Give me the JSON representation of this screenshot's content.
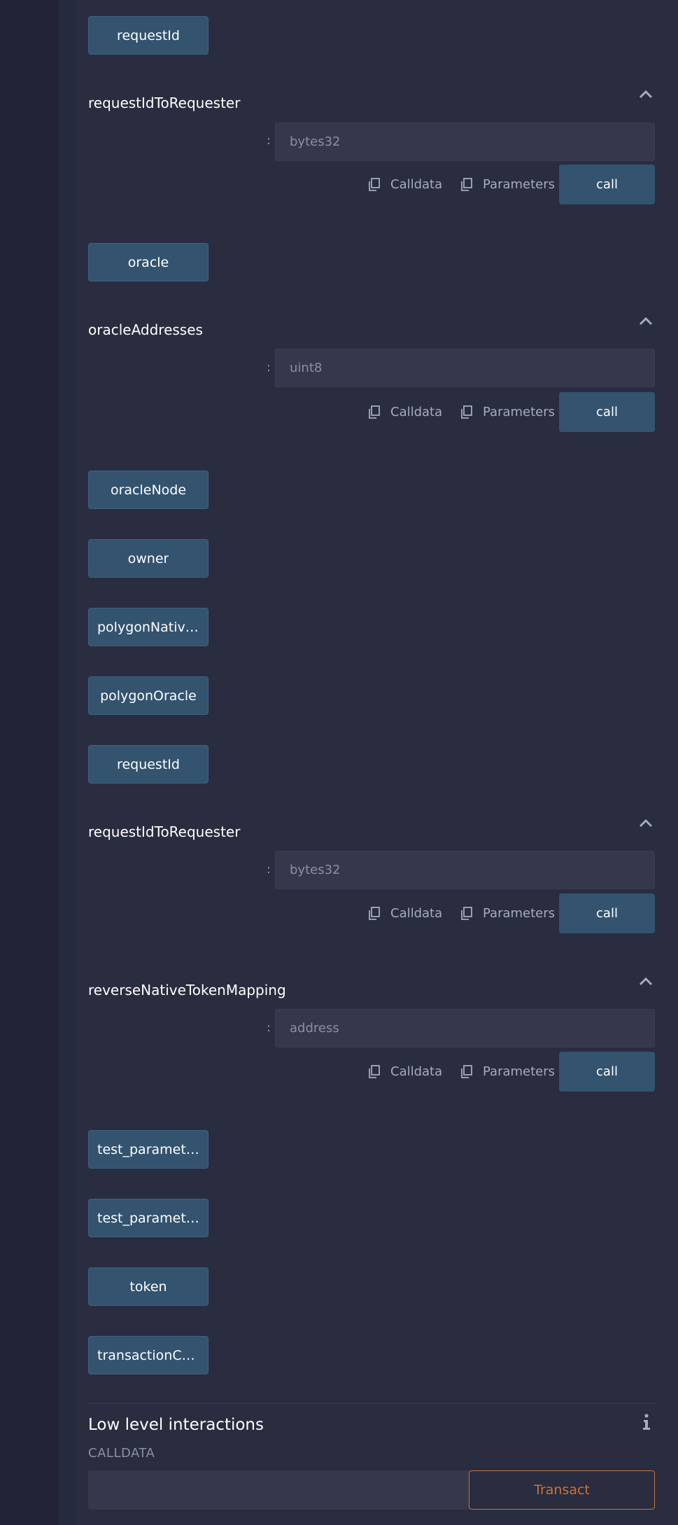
{
  "colors": {
    "background": "#2a2c3f",
    "button": "#33536f",
    "input": "#35374c",
    "accent": "#c97539"
  },
  "icons": {
    "caret": "chevron-up-icon",
    "copy": "copy-icon",
    "info": "info-icon"
  },
  "buttons": {
    "requestId_top": "requestId",
    "oracle": "oracle",
    "oracleNode": "oracleNode",
    "owner": "owner",
    "polygonNative": "polygonNative…",
    "polygonOracle": "polygonOracle",
    "requestId_mid": "requestId",
    "test_param_1": "test_paramete…",
    "test_param_2": "test_paramete…",
    "token": "token",
    "transactionCo": "transactionCo…"
  },
  "functions": [
    {
      "title": "requestIdToRequester",
      "colon": ":",
      "placeholder": "bytes32",
      "calldata": "Calldata",
      "parameters": "Parameters",
      "call": "call"
    },
    {
      "title": "oracleAddresses",
      "colon": ":",
      "placeholder": "uint8",
      "calldata": "Calldata",
      "parameters": "Parameters",
      "call": "call"
    },
    {
      "title": "requestIdToRequester",
      "colon": ":",
      "placeholder": "bytes32",
      "calldata": "Calldata",
      "parameters": "Parameters",
      "call": "call"
    },
    {
      "title": "reverseNativeTokenMapping",
      "colon": ":",
      "placeholder": "address",
      "calldata": "Calldata",
      "parameters": "Parameters",
      "call": "call"
    }
  ],
  "low_level": {
    "title": "Low level interactions",
    "calldata_label": "CALLDATA",
    "transact": "Transact"
  }
}
